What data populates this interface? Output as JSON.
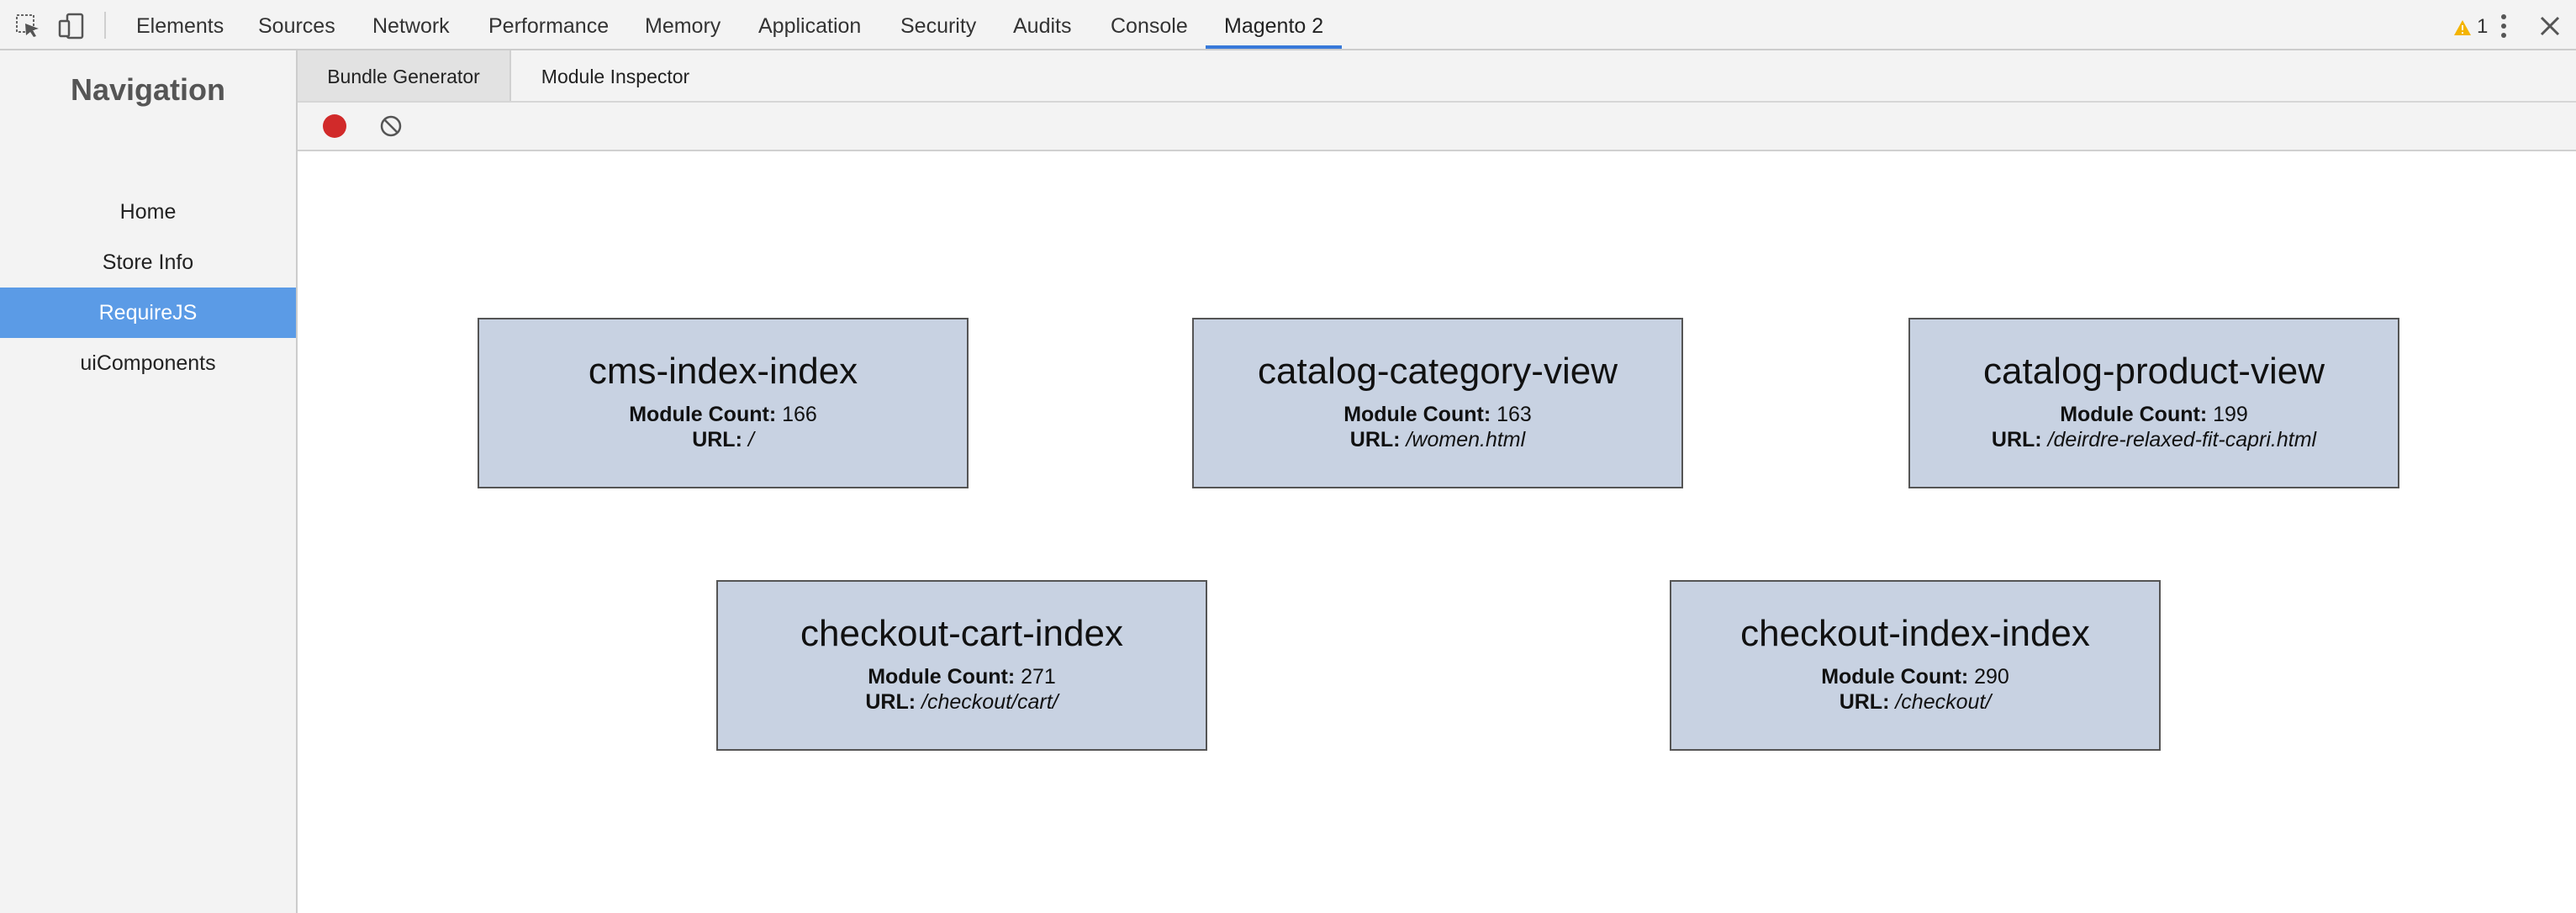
{
  "devtools": {
    "tabs": [
      "Elements",
      "Sources",
      "Network",
      "Performance",
      "Memory",
      "Application",
      "Security",
      "Audits",
      "Console",
      "Magento 2"
    ],
    "active_tab": "Magento 2",
    "warning_count": "1",
    "accent_color": "#3879d9",
    "warning_color": "#f4b400"
  },
  "nav": {
    "title": "Navigation",
    "items": [
      "Home",
      "Store Info",
      "RequireJS",
      "uiComponents"
    ],
    "active_item": "RequireJS",
    "active_color": "#5b9be6"
  },
  "panel": {
    "tabs": [
      "Bundle Generator",
      "Module Inspector"
    ],
    "active_tab": "Bundle Generator"
  },
  "toolbar": {
    "record_icon": "record-icon",
    "clear_icon": "clear-icon"
  },
  "labels": {
    "module_count": "Module Count:",
    "url": "URL:"
  },
  "bundles": [
    {
      "name": "cms-index-index",
      "module_count": "166",
      "url": "/"
    },
    {
      "name": "catalog-category-view",
      "module_count": "163",
      "url": "/women.html"
    },
    {
      "name": "catalog-product-view",
      "module_count": "199",
      "url": "/deirdre-relaxed-fit-capri.html"
    },
    {
      "name": "checkout-cart-index",
      "module_count": "271",
      "url": "/checkout/cart/"
    },
    {
      "name": "checkout-index-index",
      "module_count": "290",
      "url": "/checkout/"
    }
  ],
  "bundle_color": "#c8d2e2"
}
